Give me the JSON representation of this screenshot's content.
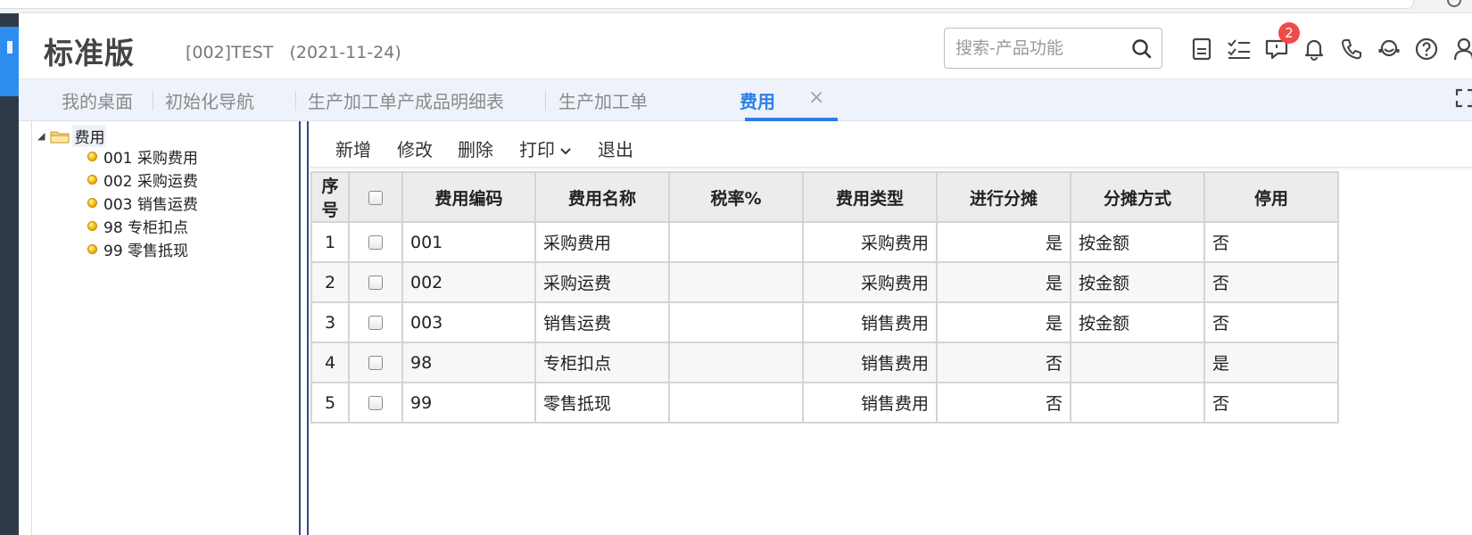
{
  "header": {
    "app_title": "标准版",
    "account": "[002]TEST   (2021-11-24)",
    "search_placeholder": "搜索-产品功能",
    "notification_count": "2"
  },
  "tabs": [
    {
      "label": "我的桌面"
    },
    {
      "label": "初始化导航"
    },
    {
      "label": "生产加工单产成品明细表"
    },
    {
      "label": "生产加工单"
    },
    {
      "label": "费用"
    }
  ],
  "tree": {
    "root": "费用",
    "items": [
      {
        "label": "001 采购费用"
      },
      {
        "label": "002 采购运费"
      },
      {
        "label": "003 销售运费"
      },
      {
        "label": "98 专柜扣点"
      },
      {
        "label": "99 零售抵现"
      }
    ]
  },
  "toolbar": {
    "add": "新增",
    "edit": "修改",
    "delete": "删除",
    "print": "打印",
    "exit": "退出"
  },
  "table": {
    "headers": {
      "seq": "序号",
      "code": "费用编码",
      "name": "费用名称",
      "tax": "税率%",
      "type": "费用类型",
      "split": "进行分摊",
      "mode": "分摊方式",
      "stop": "停用"
    },
    "rows": [
      {
        "seq": "1",
        "code": "001",
        "name": "采购费用",
        "tax": "",
        "type": "采购费用",
        "split": "是",
        "mode": "按金额",
        "stop": "否"
      },
      {
        "seq": "2",
        "code": "002",
        "name": "采购运费",
        "tax": "",
        "type": "采购费用",
        "split": "是",
        "mode": "按金额",
        "stop": "否"
      },
      {
        "seq": "3",
        "code": "003",
        "name": "销售运费",
        "tax": "",
        "type": "销售费用",
        "split": "是",
        "mode": "按金额",
        "stop": "否"
      },
      {
        "seq": "4",
        "code": "98",
        "name": "专柜扣点",
        "tax": "",
        "type": "销售费用",
        "split": "否",
        "mode": "",
        "stop": "是"
      },
      {
        "seq": "5",
        "code": "99",
        "name": "零售抵现",
        "tax": "",
        "type": "销售费用",
        "split": "否",
        "mode": "",
        "stop": "否"
      }
    ]
  },
  "colors": {
    "accent": "#2d7fe3",
    "rail": "#2f3a48",
    "badge": "#f04b4b"
  }
}
